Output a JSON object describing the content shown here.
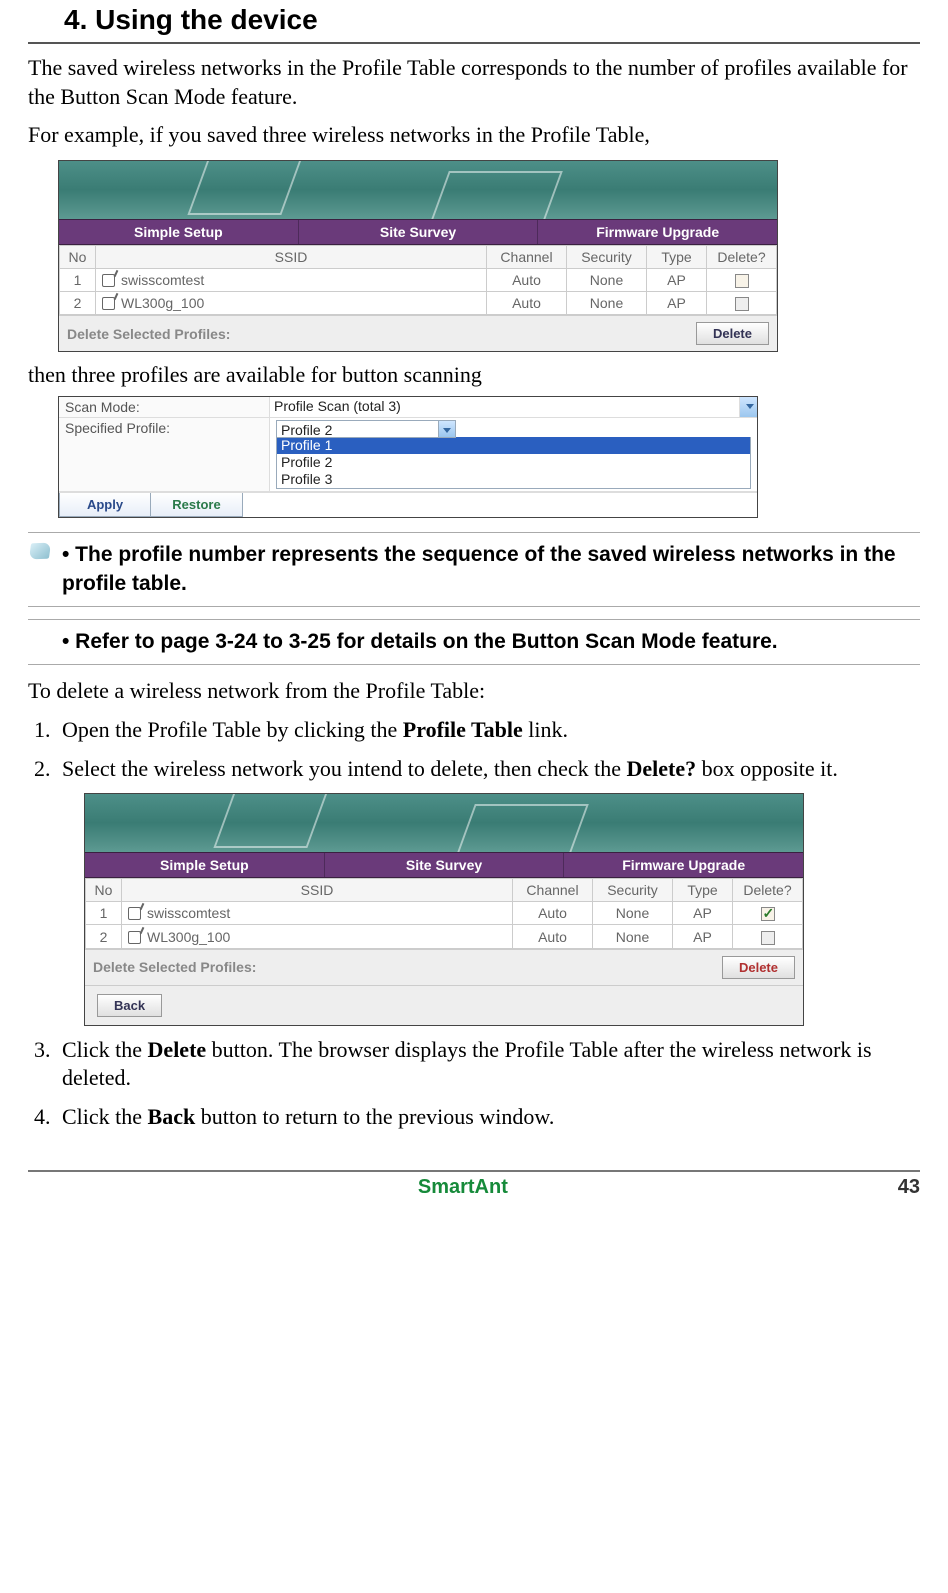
{
  "heading": "4. Using the device",
  "intro1": "The saved wireless networks in the Profile Table corresponds to the number of profiles available for the Button Scan Mode feature.",
  "intro2": "For example, if you saved three wireless networks in the Profile Table,",
  "caption1": "then three profiles are available for button scanning",
  "notes": {
    "n1": "•  The profile number represents the sequence of the saved wireless networks in the profile table.",
    "n2": "•  Refer to page 3-24 to 3-25 for details on the Button Scan Mode feature."
  },
  "delete_intro": "To delete a wireless network from the Profile Table:",
  "steps": {
    "s1a": "Open the Profile Table by clicking the ",
    "s1b": "Profile Table",
    "s1c": " link.",
    "s2a": "Select the wireless network you intend to delete, then check the ",
    "s2b": "Delete?",
    "s2c": " box opposite it.",
    "s3a": "Click the ",
    "s3b": "Delete",
    "s3c": " button. The browser displays the Profile Table after the wireless network is deleted.",
    "s4a": "Click the ",
    "s4b": "Back",
    "s4c": " button to return to the previous window."
  },
  "tabs": {
    "t1": "Simple Setup",
    "t2": "Site Survey",
    "t3": "Firmware Upgrade"
  },
  "ptable": {
    "headers": {
      "no": "No",
      "ssid": "SSID",
      "channel": "Channel",
      "security": "Security",
      "type": "Type",
      "delete": "Delete?"
    },
    "rows": [
      {
        "no": "1",
        "ssid": "swisscomtest",
        "channel": "Auto",
        "security": "None",
        "type": "AP"
      },
      {
        "no": "2",
        "ssid": "WL300g_100",
        "channel": "Auto",
        "security": "None",
        "type": "AP"
      }
    ],
    "delsel": "Delete Selected Profiles:",
    "delete_btn": "Delete",
    "back_btn": "Back"
  },
  "scan": {
    "mode_label": "Scan Mode:",
    "mode_value": "Profile Scan (total 3)",
    "prof_label": "Specified Profile:",
    "prof_value": "Profile 2",
    "options": [
      "Profile 1",
      "Profile 2",
      "Profile 3"
    ],
    "apply": "Apply",
    "restore": "Restore"
  },
  "footer": {
    "brand": "SmartAnt",
    "page": "43"
  }
}
